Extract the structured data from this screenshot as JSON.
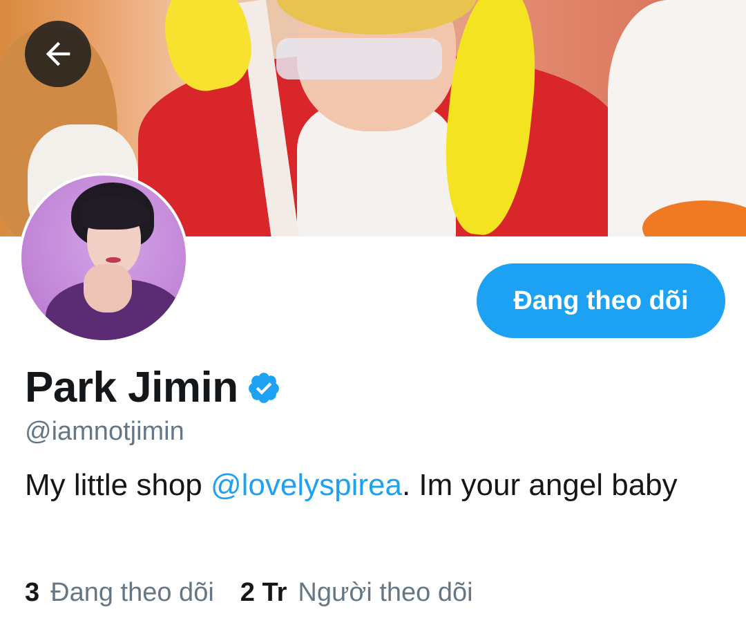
{
  "header": {
    "back_icon": "arrow-left-icon"
  },
  "profile": {
    "display_name": "Park Jimin",
    "verified_icon": "verified-badge-icon",
    "handle": "@iamnotjimin",
    "follow_button_label": "Đang theo dõi",
    "bio": {
      "text_before": "My little shop ",
      "mention": "@lovelyspirea",
      "text_after": ". Im your angel baby"
    }
  },
  "stats": {
    "following": {
      "count": "3",
      "label": "Đang theo dõi"
    },
    "followers": {
      "count": "2 Tr",
      "label": "Người theo dõi"
    }
  },
  "colors": {
    "accent": "#1da1f2",
    "primary_text": "#14171a",
    "secondary_text": "#657786",
    "background": "#ffffff"
  }
}
